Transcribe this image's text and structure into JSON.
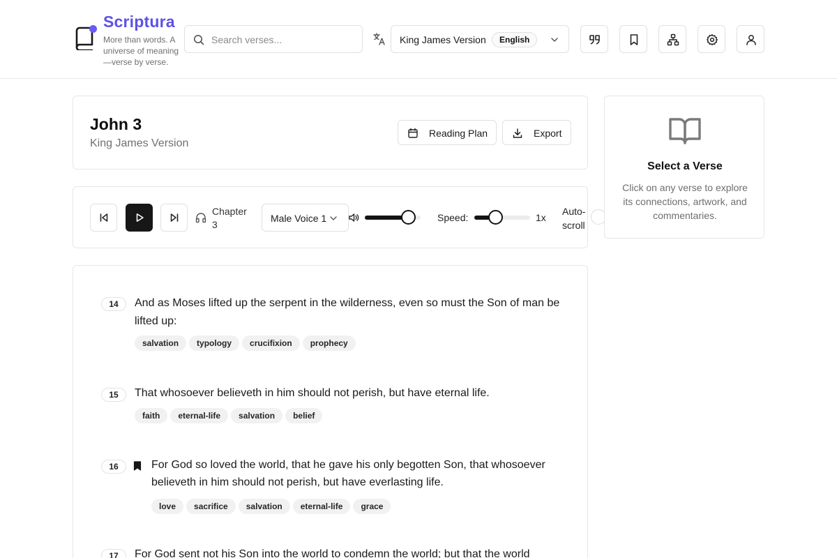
{
  "header": {
    "brand": "Scriptura",
    "tagline": "More than words. A universe of meaning—verse by verse.",
    "search_placeholder": "Search verses...",
    "version": "King James Version",
    "language": "English",
    "icon_buttons": [
      "quote-icon",
      "bookmark-icon",
      "network-icon",
      "gear-icon",
      "user-icon"
    ]
  },
  "chapter": {
    "title": "John 3",
    "subtitle": "King James Version",
    "reading_plan_label": "Reading Plan",
    "export_label": "Export"
  },
  "player": {
    "chapter_label": "Chapter 3",
    "voice": "Male Voice 1",
    "volume": 0.78,
    "speed_label": "Speed:",
    "speed_value": "1x",
    "speed_position": 0.38,
    "autoscroll_label": "Auto-scroll",
    "autoscroll_on": false
  },
  "side_panel": {
    "title": "Select a Verse",
    "text": "Click on any verse to explore its connections, artwork, and commentaries."
  },
  "verses": [
    {
      "number": "14",
      "text": "And as Moses lifted up the serpent in the wilderness, even so must the Son of man be lifted up:",
      "bookmarked": false,
      "tags": [
        "salvation",
        "typology",
        "crucifixion",
        "prophecy"
      ]
    },
    {
      "number": "15",
      "text": "That whosoever believeth in him should not perish, but have eternal life.",
      "bookmarked": false,
      "tags": [
        "faith",
        "eternal-life",
        "salvation",
        "belief"
      ]
    },
    {
      "number": "16",
      "text": "For God so loved the world, that he gave his only begotten Son, that whosoever believeth in him should not perish, but have everlasting life.",
      "bookmarked": true,
      "tags": [
        "love",
        "sacrifice",
        "salvation",
        "eternal-life",
        "grace"
      ]
    },
    {
      "number": "17",
      "text": "For God sent not his Son into the world to condemn the world; but that the world",
      "bookmarked": false,
      "tags": []
    }
  ],
  "colors": {
    "brand": "#5b52e6",
    "accent_dot": "#6a5cf0",
    "dark": "#171717"
  }
}
